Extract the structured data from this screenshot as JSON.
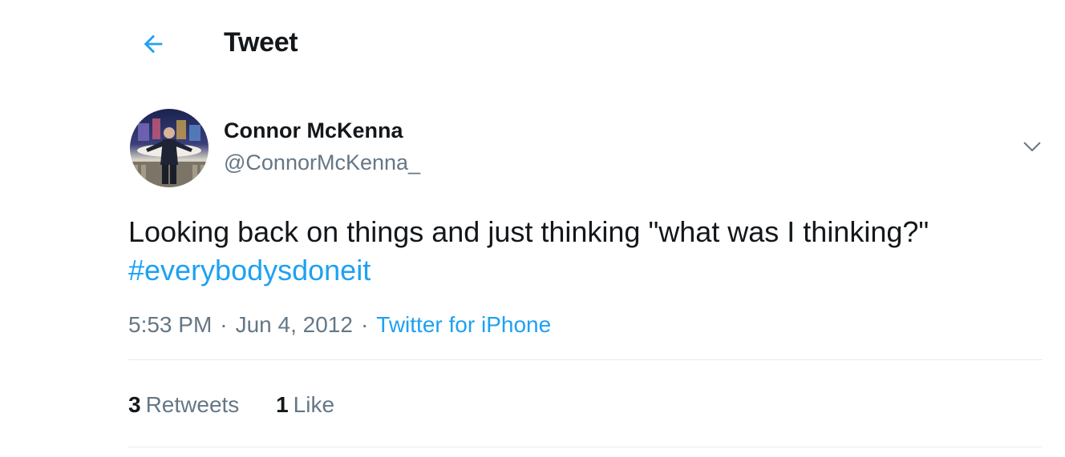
{
  "header": {
    "back_icon": "arrow-left-icon",
    "title": "Tweet"
  },
  "colors": {
    "accent": "#1da1f2",
    "text_primary": "#14171a",
    "text_secondary": "#657786",
    "divider": "#e6ecf0"
  },
  "tweet": {
    "author": {
      "display_name": "Connor McKenna",
      "handle": "@ConnorMcKenna_",
      "avatar_icon": "profile-photo"
    },
    "menu_icon": "chevron-down-icon",
    "text_before": "Looking back on things and just thinking \"what was I thinking?\" ",
    "hashtag": "#everybodysdoneit",
    "time": "5:53 PM",
    "separator": "·",
    "date": "Jun 4, 2012",
    "source": "Twitter for iPhone"
  },
  "stats": {
    "retweets_count": "3",
    "retweets_label": "Retweets",
    "likes_count": "1",
    "likes_label": "Like"
  }
}
